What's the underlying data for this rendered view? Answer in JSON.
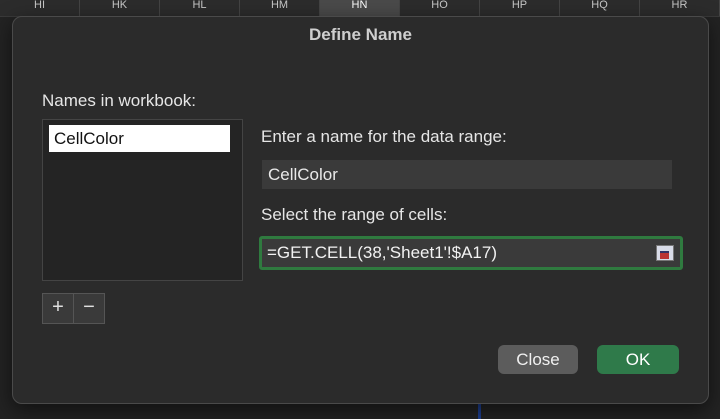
{
  "spreadsheet": {
    "column_headers": [
      "HI",
      "HK",
      "HL",
      "HM",
      "HN",
      "HO",
      "HP",
      "HQ",
      "HR"
    ],
    "selected_column": "HN"
  },
  "dialog": {
    "title": "Define Name",
    "names_label": "Names in workbook:",
    "names": [
      "CellColor"
    ],
    "add_label": "+",
    "remove_label": "−",
    "enter_label": "Enter a name for the data range:",
    "name_value": "CellColor",
    "range_label": "Select the range of cells:",
    "range_value": "=GET.CELL(38,'Sheet1'!$A17)",
    "close_label": "Close",
    "ok_label": "OK"
  },
  "colors": {
    "dialog_bg": "#2b2b2b",
    "accent_green": "#2f7a4a",
    "focus_border": "#2f7a3f"
  }
}
